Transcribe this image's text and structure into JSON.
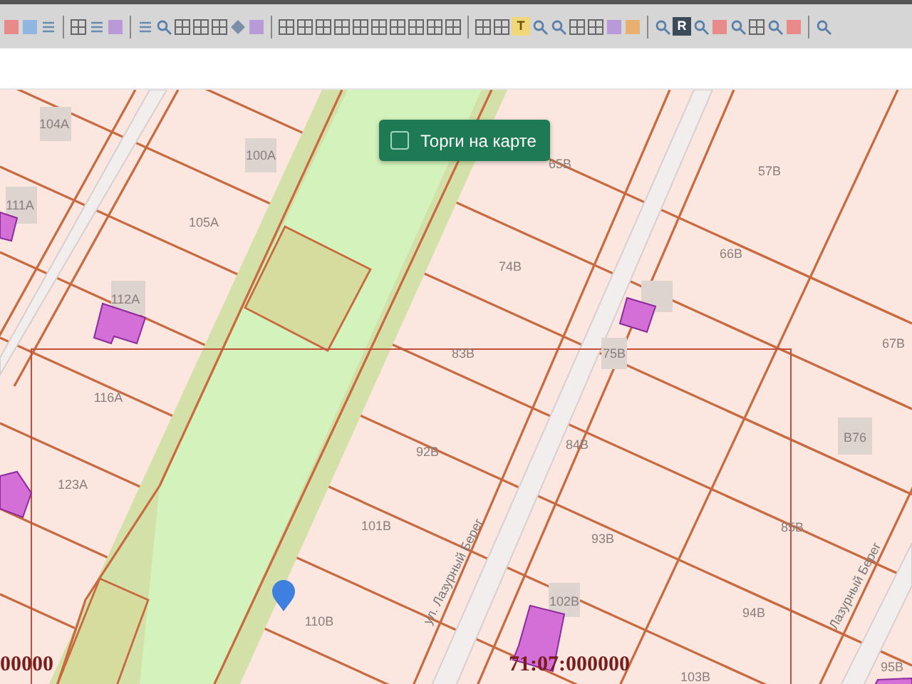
{
  "toolbar": {
    "letter_buttons": [
      {
        "label": "T"
      },
      {
        "label": "R"
      }
    ]
  },
  "map": {
    "auction_toggle": {
      "label": "Торги на карте",
      "checked": false
    },
    "plots": [
      "104А",
      "100А",
      "111А",
      "105А",
      "112А",
      "116А",
      "123А",
      "65В",
      "57В",
      "74В",
      "66В",
      "83В",
      "75В",
      "67В",
      "84В",
      "92В",
      "В76",
      "101В",
      "93В",
      "85В",
      "102В",
      "94В",
      "110В",
      "103В",
      "95В"
    ],
    "streets": [
      "ул. Лазурный Берег",
      "Лазурный Берег"
    ],
    "cadastral_numbers": [
      "00000",
      "71:07:000000"
    ]
  }
}
